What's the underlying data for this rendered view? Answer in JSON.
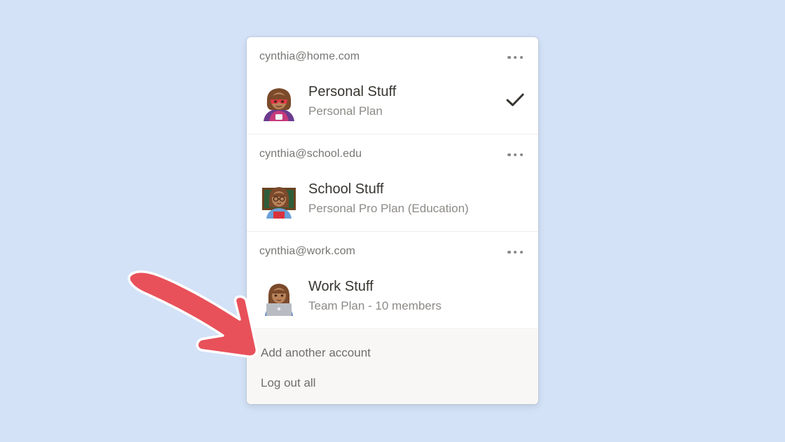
{
  "accounts": [
    {
      "email": "cynthia@home.com",
      "workspace": "Personal Stuff",
      "plan": "Personal Plan",
      "avatar": "superhero-woman-avatar",
      "selected": true
    },
    {
      "email": "cynthia@school.edu",
      "workspace": "School Stuff",
      "plan": "Personal Pro Plan (Education)",
      "avatar": "teacher-woman-avatar",
      "selected": false
    },
    {
      "email": "cynthia@work.com",
      "workspace": "Work Stuff",
      "plan": "Team Plan - 10 members",
      "avatar": "technologist-woman-avatar",
      "selected": false
    }
  ],
  "footer": {
    "add_account": "Add another account",
    "logout_all": "Log out all"
  },
  "icons": {
    "more": "more-horizontal-icon",
    "selected": "checkmark-icon",
    "annotation": "red-arrow-pointer"
  },
  "colors": {
    "background": "#d3e2f7",
    "arrow": "#e8515a",
    "text_primary": "#37352f",
    "text_secondary": "#8d8b87"
  }
}
